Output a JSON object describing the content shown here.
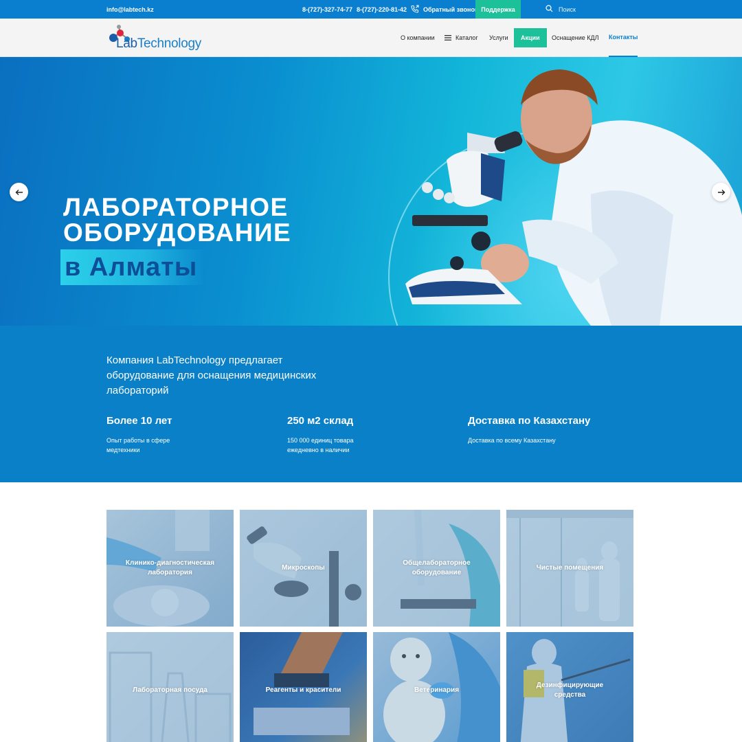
{
  "topbar": {
    "email": "info@labtech.kz",
    "phone1": "8-(727)-327-74-77",
    "phone2": "8-(727)-220-81-42",
    "callback": "Обратный звонок",
    "support": "Поддержка",
    "search_placeholder": "Поиск"
  },
  "logo": {
    "part1": "Lab",
    "part2": "Technology"
  },
  "nav": {
    "about": "О компании",
    "catalog": "Каталог",
    "services": "Услуги",
    "promo": "Акции",
    "kdl": "Оснащение КДЛ",
    "contacts": "Контакты"
  },
  "hero": {
    "line1": "ЛАБОРАТОРНОЕ",
    "line2": "ОБОРУДОВАНИЕ",
    "line3": "в Алматы"
  },
  "info": {
    "lead": "Компания LabTechnology предлагает оборудование для оснащения медицинских лабораторий",
    "stats": [
      {
        "title": "Более 10 лет",
        "desc": "Опыт работы в сфере медтехники"
      },
      {
        "title": "250 м2 склад",
        "desc": "150 000 единиц товара ежедневно в наличии"
      },
      {
        "title": "Доставка по Казахстану",
        "desc": "Доставка по всему Казахстану"
      }
    ]
  },
  "categories": [
    {
      "label": "Клинико-диагностическая лаборатория"
    },
    {
      "label": "Микроскопы"
    },
    {
      "label": "Общелабораторное оборудование"
    },
    {
      "label": "Чистые помещения"
    },
    {
      "label": "Лабораторная посуда"
    },
    {
      "label": "Реагенты и красители"
    },
    {
      "label": "Ветеринария"
    },
    {
      "label": "Дезинфицирующие средства"
    }
  ],
  "colors": {
    "primary": "#0a7fcf",
    "accent_green": "#1cc19a",
    "hero_dark": "#0c4f98"
  }
}
